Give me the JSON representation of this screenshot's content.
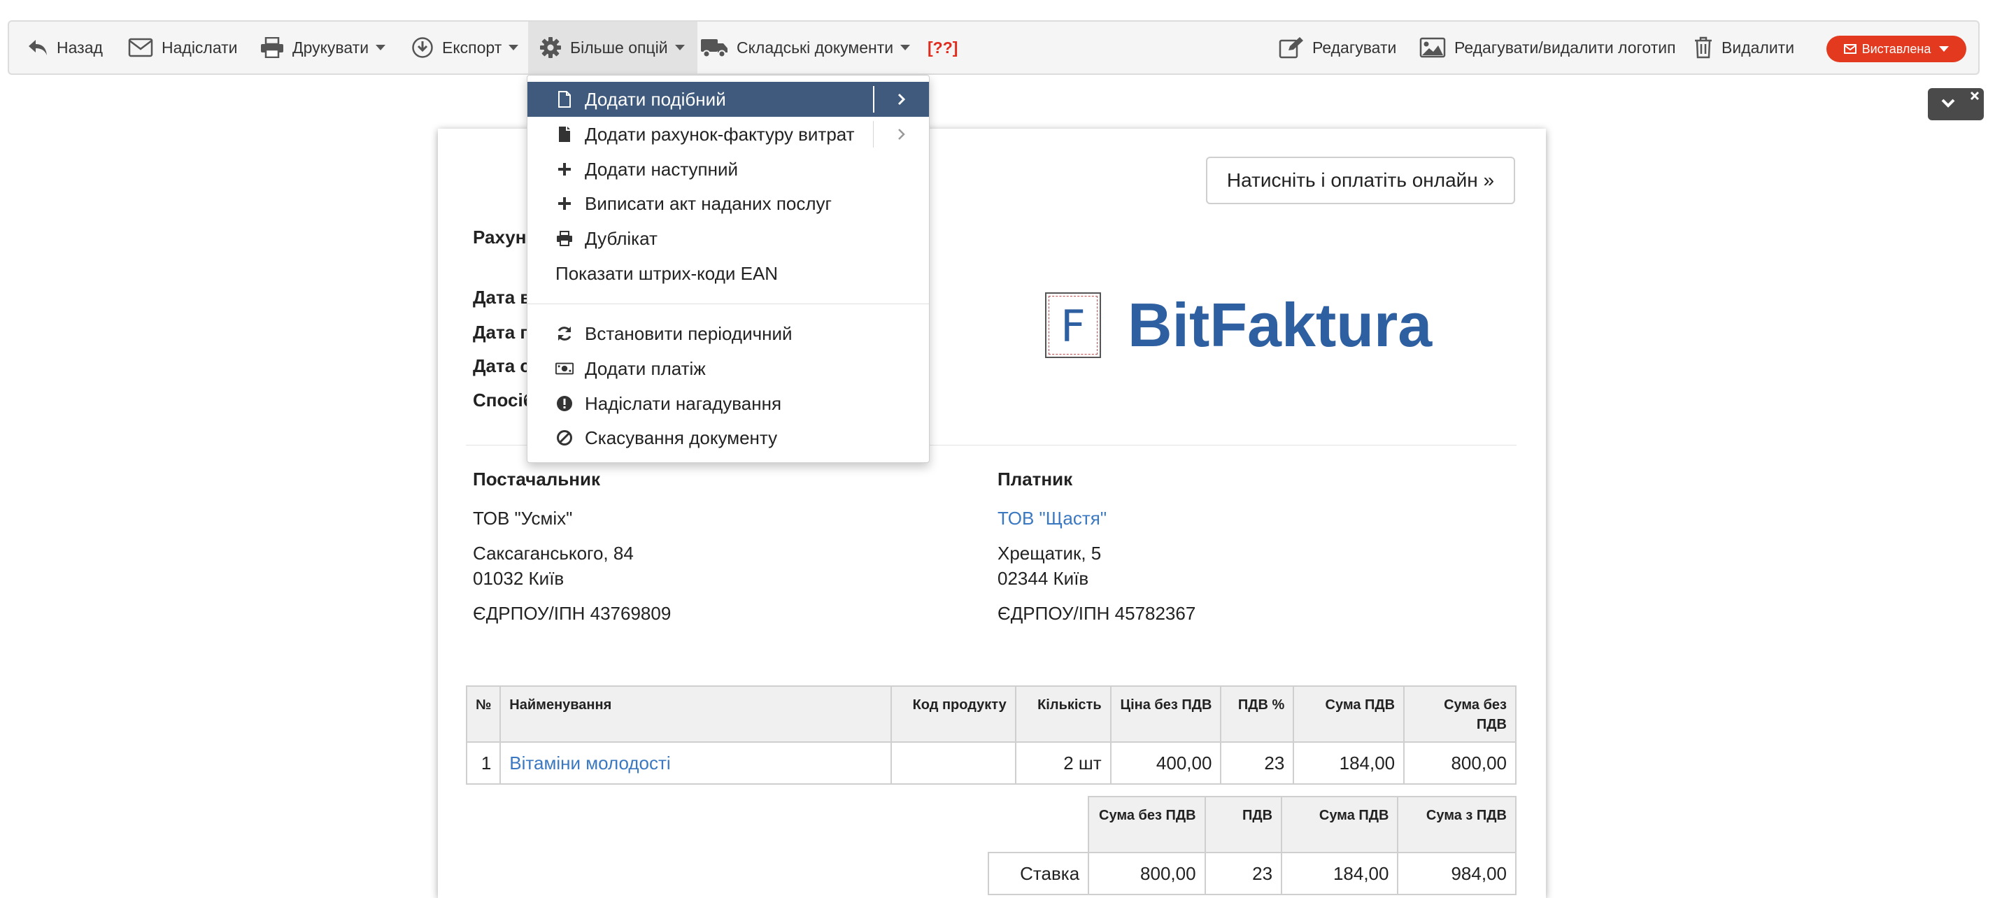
{
  "toolbar": {
    "back": "Назад",
    "send": "Надіслати",
    "print": "Друкувати",
    "export": "Експорт",
    "more_options": "Більше опцій",
    "warehouse_docs": "Складські документи",
    "error_marker": "[??]",
    "edit": "Редагувати",
    "edit_logo": "Редагувати/видалити логотип",
    "delete": "Видалити",
    "status": "Виставлена"
  },
  "menu": {
    "items": [
      {
        "label": "Додати подібний",
        "icon": "file-outline-icon",
        "has_submenu": true,
        "active": true
      },
      {
        "label": "Додати рахунок-фактуру витрат",
        "icon": "file-solid-icon",
        "has_submenu": true
      },
      {
        "label": "Додати наступний",
        "icon": "plus-icon"
      },
      {
        "label": "Виписати акт наданих послуг",
        "icon": "plus-icon"
      },
      {
        "label": "Дублікат",
        "icon": "printer-icon"
      },
      {
        "label": "Показати штрих-коди EAN",
        "icon": ""
      },
      {
        "label": "Встановити періодичний",
        "icon": "refresh-icon"
      },
      {
        "label": "Додати платіж",
        "icon": "money-icon"
      },
      {
        "label": "Надіслати нагадування",
        "icon": "exclamation-circle-icon"
      },
      {
        "label": "Скасування документу",
        "icon": "ban-icon"
      }
    ]
  },
  "invoice": {
    "pay_online": "Натисніть і оплатіть онлайн »",
    "title_partial": "Рахун",
    "meta_partial": [
      "Дата в",
      "Дата п",
      "Дата с",
      "Спосіб"
    ],
    "logo_letter": "F",
    "logo_text": "BitFaktura",
    "supplier": {
      "heading": "Постачальник",
      "name": "ТОВ \"Усміх\"",
      "street": "Саксаганського, 84",
      "city": "01032 Київ",
      "tax_id": "ЄДРПОУ/ІПН 43769809"
    },
    "payer": {
      "heading": "Платник",
      "name": "ТОВ \"Щастя\"",
      "street": "Хрещатик, 5",
      "city": "02344 Київ",
      "tax_id": "ЄДРПОУ/ІПН 45782367"
    },
    "items_table": {
      "headers": [
        "№",
        "Найменування",
        "Код продукту",
        "Кількість",
        "Ціна без ПДВ",
        "ПДВ %",
        "Сума ПДВ",
        "Сума без ПДВ"
      ],
      "rows": [
        [
          "1",
          "Вітаміни молодості",
          "",
          "2 шт",
          "400,00",
          "23",
          "184,00",
          "800,00"
        ]
      ]
    },
    "summary_table": {
      "headers": [
        "Сума без ПДВ",
        "ПДВ",
        "Сума ПДВ",
        "Сума з ПДВ"
      ],
      "row_label": "Ставка",
      "rows": [
        [
          "800,00",
          "23",
          "184,00",
          "984,00"
        ]
      ]
    }
  },
  "colors": {
    "accent": "#3b78c2",
    "menu_active": "#3f5a7c",
    "status": "#e33a1f",
    "error": "#e02c1e",
    "logo": "#2e5fa0"
  }
}
